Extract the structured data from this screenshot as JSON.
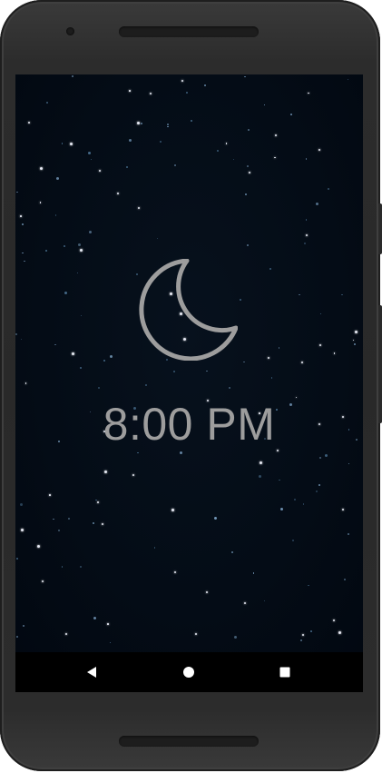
{
  "screen": {
    "icon": "moon-icon",
    "time": "8:00 PM",
    "background_color": "#020b14",
    "text_color": "#9d9d9d"
  },
  "navbar": {
    "back_icon": "back-triangle-icon",
    "home_icon": "home-circle-icon",
    "recents_icon": "recents-square-icon"
  }
}
